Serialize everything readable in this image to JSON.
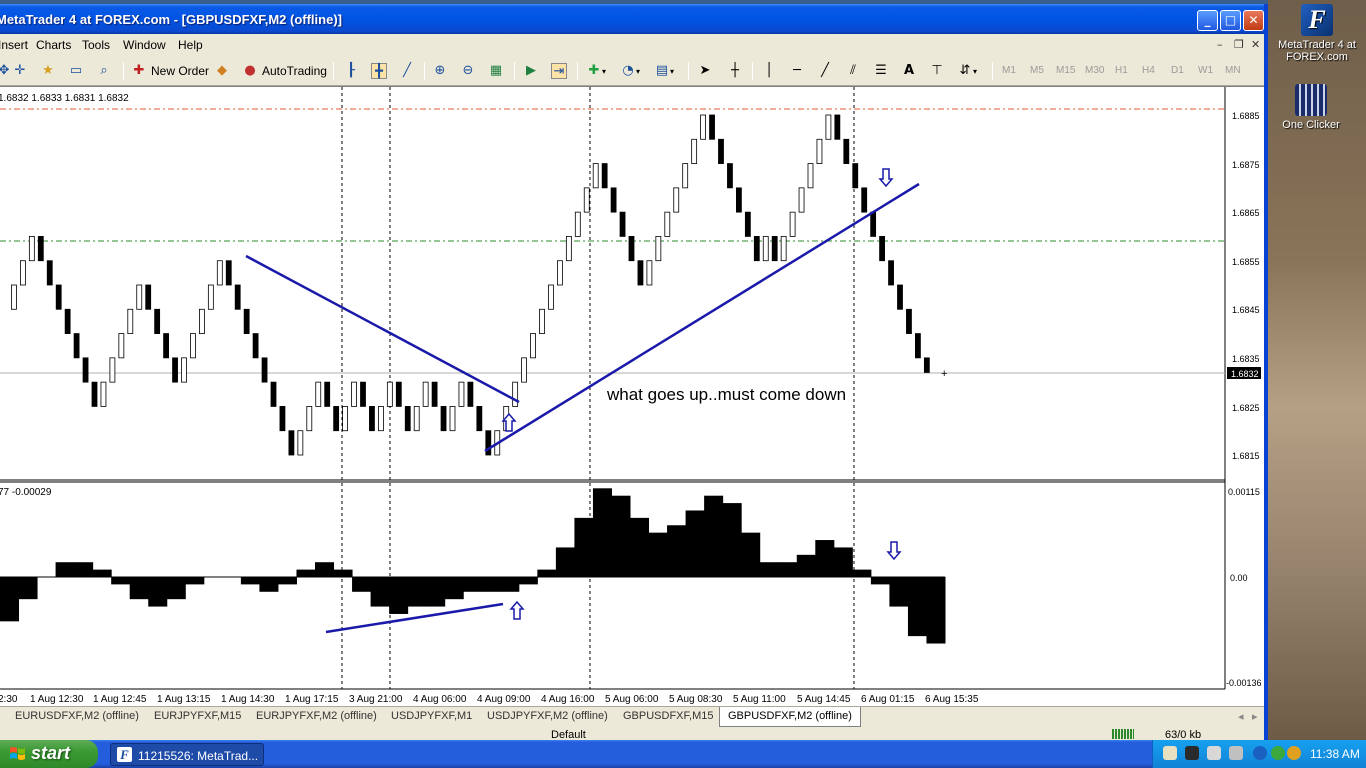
{
  "window": {
    "title": "MetaTrader 4 at FOREX.com - [GBPUSDFXF,M2 (offline)]"
  },
  "menu": [
    "Insert",
    "Charts",
    "Tools",
    "Window",
    "Help"
  ],
  "toolbar": {
    "new_order_label": "New Order",
    "autotrading_label": "AutoTrading",
    "timeframes": [
      "M1",
      "M5",
      "M15",
      "M30",
      "H1",
      "H4",
      "D1",
      "W1",
      "MN"
    ]
  },
  "chart": {
    "ohlc_header": "1.6832 1.6833 1.6831 1.6832",
    "indicator_header": "77 -0.00029",
    "annotation": "what goes up..must come down",
    "price_labels": [
      "1.6885",
      "1.6875",
      "1.6865",
      "1.6855",
      "1.6845",
      "1.6835",
      "1.6825",
      "1.6815"
    ],
    "current_price": "1.6832",
    "indicator_labels": [
      "0.00115",
      "0.00",
      "-0.00136"
    ],
    "time_labels": [
      "1 Aug 12:30",
      "1 Aug 12:45",
      "1 Aug 13:15",
      "1 Aug 14:30",
      "1 Aug 17:15",
      "3 Aug 21:00",
      "4 Aug 06:00",
      "4 Aug 09:00",
      "4 Aug 16:00",
      "5 Aug 06:00",
      "5 Aug 08:30",
      "5 Aug 11:00",
      "5 Aug 14:45",
      "6 Aug 01:15",
      "6 Aug 15:35"
    ],
    "time_label_partial": "2:30"
  },
  "chart_data": {
    "type": "line",
    "title": "GBPUSDFXF,M2 (offline)",
    "ylim": [
      1.681,
      1.689
    ],
    "series": [
      {
        "name": "GBPUSDFXF",
        "values": [
          1.6845,
          1.685,
          1.6855,
          1.686,
          1.6855,
          1.685,
          1.6845,
          1.684,
          1.6835,
          1.683,
          1.6825,
          1.683,
          1.6835,
          1.684,
          1.6845,
          1.685,
          1.6845,
          1.684,
          1.6835,
          1.683,
          1.6835,
          1.684,
          1.6845,
          1.685,
          1.6855,
          1.685,
          1.6845,
          1.684,
          1.6835,
          1.683,
          1.6825,
          1.682,
          1.6815,
          1.682,
          1.6825,
          1.683,
          1.6825,
          1.682,
          1.6825,
          1.683,
          1.6825,
          1.682,
          1.6825,
          1.683,
          1.6825,
          1.682,
          1.6825,
          1.683,
          1.6825,
          1.682,
          1.6825,
          1.683,
          1.6825,
          1.682,
          1.6815,
          1.682,
          1.6825,
          1.683,
          1.6835,
          1.684,
          1.6845,
          1.685,
          1.6855,
          1.686,
          1.6865,
          1.687,
          1.6875,
          1.687,
          1.6865,
          1.686,
          1.6855,
          1.685,
          1.6855,
          1.686,
          1.6865,
          1.687,
          1.6875,
          1.688,
          1.6885,
          1.688,
          1.6875,
          1.687,
          1.6865,
          1.686,
          1.6855,
          1.686,
          1.6855,
          1.686,
          1.6865,
          1.687,
          1.6875,
          1.688,
          1.6885,
          1.688,
          1.6875,
          1.687,
          1.6865,
          1.686,
          1.6855,
          1.685,
          1.6845,
          1.684,
          1.6835,
          1.6832
        ]
      },
      {
        "name": "-0.00029",
        "values": [
          -0.0006,
          -0.0003,
          0.0,
          0.0002,
          0.0002,
          0.0001,
          -0.0001,
          -0.0003,
          -0.0004,
          -0.0003,
          -0.0001,
          0.0,
          0.0,
          -0.0001,
          -0.0002,
          -0.0001,
          0.0001,
          0.0002,
          0.0001,
          -0.0002,
          -0.0004,
          -0.0005,
          -0.0004,
          -0.0004,
          -0.0003,
          -0.0002,
          -0.0002,
          -0.0002,
          -0.0001,
          0.0001,
          0.0004,
          0.0008,
          0.0012,
          0.0011,
          0.0008,
          0.0006,
          0.0007,
          0.0009,
          0.0011,
          0.001,
          0.0006,
          0.0002,
          0.0002,
          0.0003,
          0.0005,
          0.0004,
          0.0001,
          -0.0001,
          -0.0004,
          -0.0008,
          -0.0009
        ]
      }
    ]
  },
  "tabs": [
    "EURUSDFXF,M2 (offline)",
    "EURJPYFXF,M15",
    "EURJPYFXF,M2 (offline)",
    "USDJPYFXF,M1",
    "USDJPYFXF,M2 (offline)",
    "GBPUSDFXF,M15",
    "GBPUSDFXF,M2 (offline)"
  ],
  "statusbar": {
    "profile": "Default",
    "traffic": "63/0 kb"
  },
  "taskbar": {
    "start_label": "start",
    "task_label": "11215526: MetaTrad...",
    "clock": "11:38 AM"
  },
  "desktop": {
    "icons": [
      "MetaTrader 4 at FOREX.com",
      "One Clicker"
    ]
  },
  "colors": {
    "trendline": "#1a1aaa",
    "up_candle": "#ffffff",
    "down_candle": "#000000",
    "resistance_line": "#e05a2a",
    "support_line": "#2e8b2e",
    "taskbar_blue": "#245edc",
    "start_green": "#3c9a35"
  }
}
